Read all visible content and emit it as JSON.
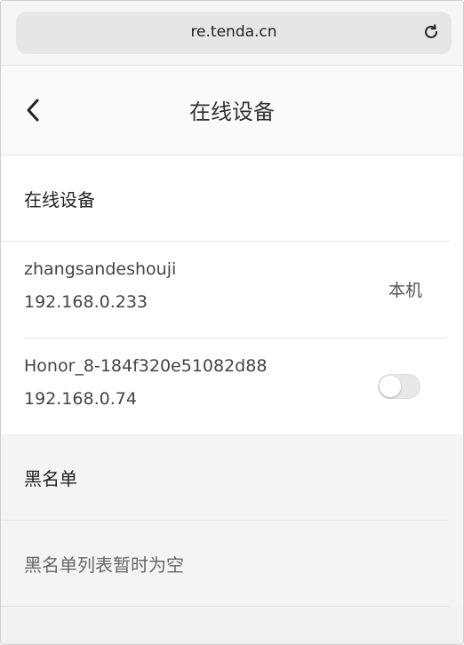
{
  "browser": {
    "url": "re.tenda.cn",
    "reload_icon": "reload-icon"
  },
  "header": {
    "back_icon": "chevron-left-icon",
    "title": "在线设备"
  },
  "online_section": {
    "heading": "在线设备",
    "devices": [
      {
        "name": "zhangsandeshouji",
        "ip": "192.168.0.233",
        "tag": "本机"
      },
      {
        "name": "Honor_8-184f320e51082d88",
        "ip": "192.168.0.74",
        "blocked": false
      }
    ]
  },
  "blacklist_section": {
    "heading": "黑名单",
    "empty_text": "黑名单列表暂时为空"
  }
}
